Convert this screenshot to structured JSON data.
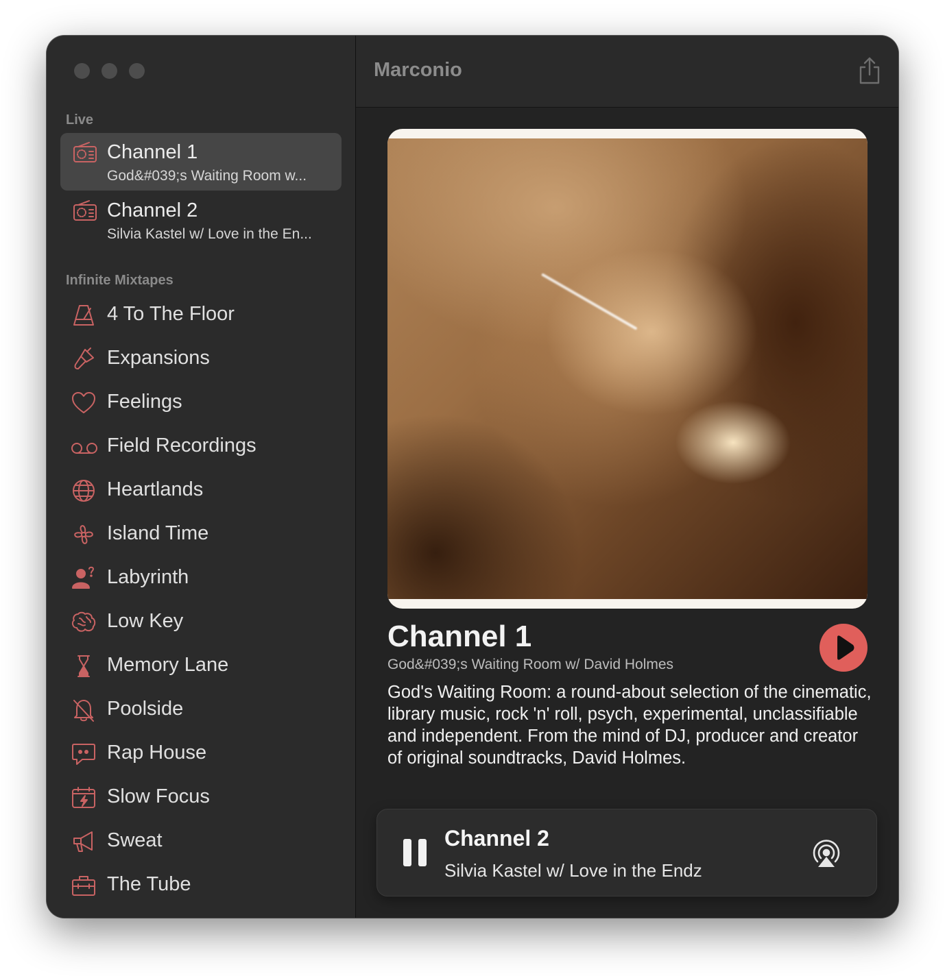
{
  "window": {
    "app_title": "Marconio"
  },
  "sidebar": {
    "live_label": "Live",
    "live_items": [
      {
        "title": "Channel 1",
        "subtitle": "God&#039;s Waiting Room w...",
        "icon": "radio-icon",
        "selected": true
      },
      {
        "title": "Channel 2",
        "subtitle": "Silvia Kastel w/ Love in the En...",
        "icon": "radio-icon",
        "selected": false
      }
    ],
    "mixtapes_label": "Infinite Mixtapes",
    "mixtapes": [
      {
        "title": "4 To The Floor",
        "icon": "metronome-icon"
      },
      {
        "title": "Expansions",
        "icon": "paintbrush-icon"
      },
      {
        "title": "Feelings",
        "icon": "heart-icon"
      },
      {
        "title": "Field Recordings",
        "icon": "voicemail-icon"
      },
      {
        "title": "Heartlands",
        "icon": "globe-icon"
      },
      {
        "title": "Island Time",
        "icon": "fan-icon"
      },
      {
        "title": "Labyrinth",
        "icon": "person-question-icon"
      },
      {
        "title": "Low Key",
        "icon": "brain-icon"
      },
      {
        "title": "Memory Lane",
        "icon": "hourglass-icon"
      },
      {
        "title": "Poolside",
        "icon": "bell-slash-icon"
      },
      {
        "title": "Rap House",
        "icon": "quote-bubble-icon"
      },
      {
        "title": "Slow Focus",
        "icon": "calendar-bolt-icon"
      },
      {
        "title": "Sweat",
        "icon": "megaphone-icon"
      },
      {
        "title": "The Tube",
        "icon": "toolbox-icon"
      }
    ]
  },
  "now_playing": {
    "title": "Channel 1",
    "subtitle": "God&#039;s Waiting Room w/ David Holmes",
    "description": "God's Waiting Room: a round-about selection of the cinematic, library music, rock 'n' roll, psych, experimental, unclassifiable and independent. From the mind of DJ, producer and creator of original soundtracks, David Holmes."
  },
  "mini_player": {
    "title": "Channel 2",
    "subtitle": "Silvia Kastel w/ Love in the Endz"
  },
  "colors": {
    "accent": "#e05f5b",
    "icon_tint": "#c96363"
  }
}
